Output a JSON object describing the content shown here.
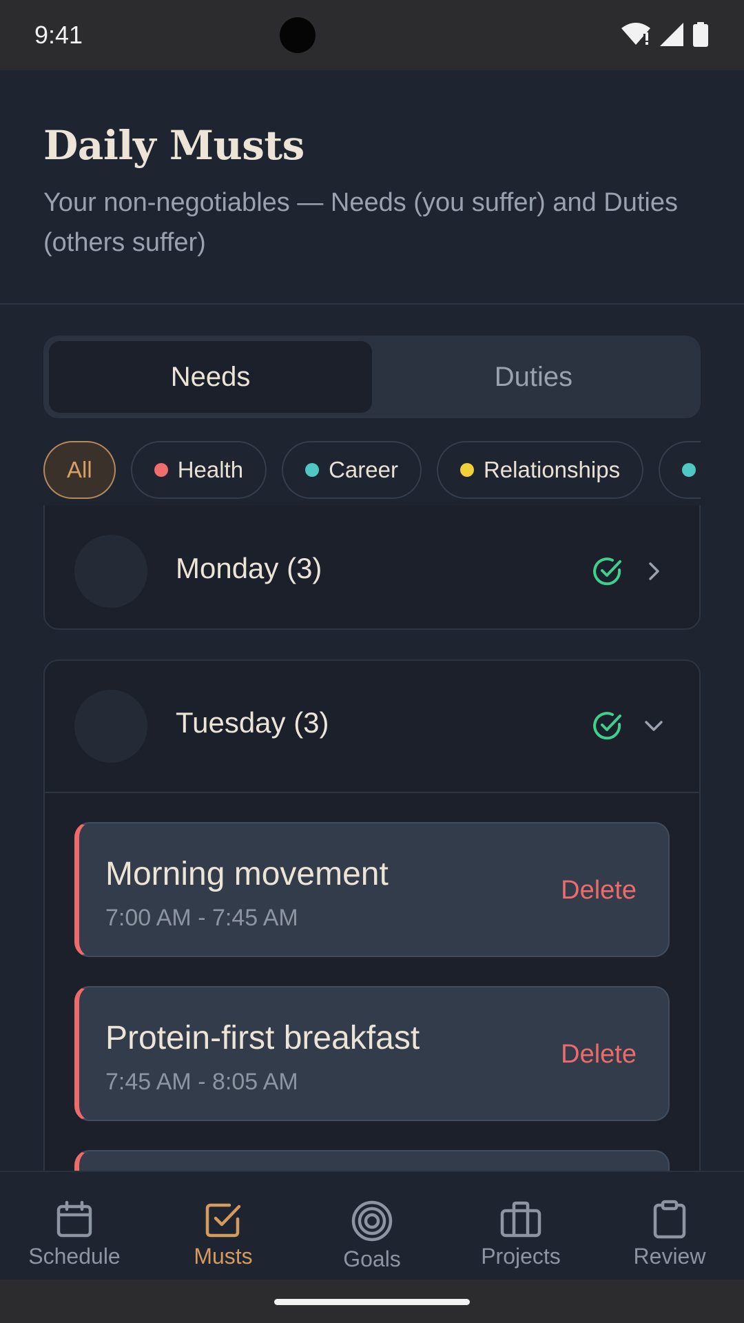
{
  "status": {
    "time": "9:41"
  },
  "header": {
    "title": "Daily Musts",
    "subtitle": "Your non-negotiables — Needs (you suffer) and Duties (others suffer)"
  },
  "tabs": [
    {
      "label": "Needs",
      "active": true
    },
    {
      "label": "Duties",
      "active": false
    }
  ],
  "filters": [
    {
      "label": "All",
      "active": true
    },
    {
      "label": "Health",
      "color": "#f26d6d"
    },
    {
      "label": "Career",
      "color": "#4fc7c2"
    },
    {
      "label": "Relationships",
      "color": "#f2d03b"
    },
    {
      "label": "",
      "color": "#4fc7c2"
    }
  ],
  "days": [
    {
      "label": "Monday (3)",
      "expanded": false
    },
    {
      "label": "Tuesday (3)",
      "expanded": true,
      "items": [
        {
          "title": "Morning movement",
          "time": "7:00 AM - 7:45 AM",
          "action": "Delete"
        },
        {
          "title": "Protein-first breakfast",
          "time": "7:45 AM - 8:05 AM",
          "action": "Delete"
        }
      ]
    }
  ],
  "nav": [
    {
      "label": "Schedule",
      "icon": "calendar-icon",
      "active": false
    },
    {
      "label": "Musts",
      "icon": "checkbox-icon",
      "active": true
    },
    {
      "label": "Goals",
      "icon": "target-icon",
      "active": false
    },
    {
      "label": "Projects",
      "icon": "briefcase-icon",
      "active": false
    },
    {
      "label": "Review",
      "icon": "clipboard-icon",
      "active": false
    }
  ],
  "colors": {
    "accent": "#d49a5e",
    "danger": "#ee6b6b",
    "success": "#3fd08f"
  }
}
